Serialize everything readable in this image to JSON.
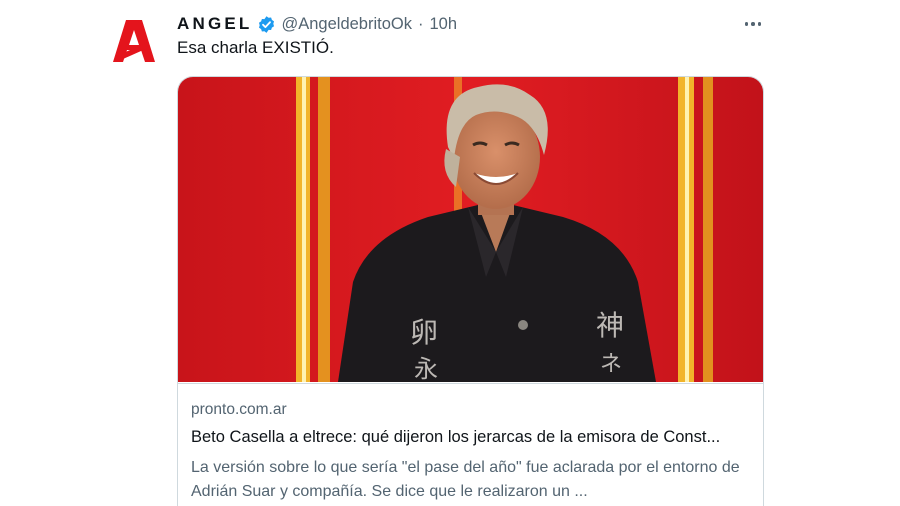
{
  "tweet": {
    "display_name": "ANGEL",
    "handle": "@AngeldebritoOk",
    "separator": "·",
    "time": "10h",
    "text": "Esa charla EXISTIÓ.",
    "avatar_letter": "A"
  },
  "card": {
    "domain": "pronto.com.ar",
    "title": "Beto Casella a eltrece: qué dijeron los jerarcas de la emisora de Const...",
    "description": "La versión sobre lo que sería \"el pase del año\" fue aclarada por el entorno de Adrián Suar y compañía. Se dice que le realizaron un ..."
  },
  "colors": {
    "brand_red": "#e4141c",
    "verified_blue": "#1d9bf0",
    "secondary_text": "#536471",
    "card_border": "#cfd9de"
  },
  "icons": {
    "verified": "verified-badge-icon",
    "more": "more-options-icon"
  }
}
